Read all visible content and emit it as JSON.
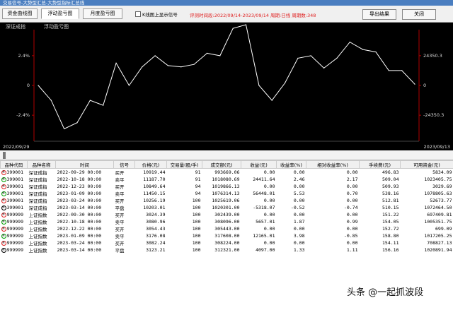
{
  "window_title": "交易信号-大势型汇总-大势型指标汇总线",
  "tabs": [
    {
      "label": "资金曲线图"
    },
    {
      "label": "浮动盈亏图"
    },
    {
      "label": "月度盈亏图"
    }
  ],
  "show_signals_label": "K线图上显示信号",
  "range_info": "评测时间段:2022/09/14-2023/09/14 周期:日线 周期数:348",
  "buttons": {
    "export": "导出结果",
    "close": "关闭"
  },
  "legend": {
    "a": "深证成指",
    "b": "浮动盈亏图"
  },
  "chart_data": {
    "type": "line",
    "x_start_label": "2022/09/29",
    "x_end_label": "2023/09/13",
    "left_ticks": [
      "2.4%",
      "0",
      "-2.4%"
    ],
    "right_ticks": [
      "24350.3",
      "0",
      "-24350.3"
    ],
    "ylim": [
      -4.5,
      4.5
    ],
    "values": [
      0.0,
      -1.2,
      -3.5,
      -3.0,
      -1.2,
      -1.6,
      1.8,
      0.0,
      1.5,
      2.4,
      1.6,
      1.5,
      1.7,
      2.6,
      2.4,
      4.6,
      4.9,
      0.0,
      -1.2,
      0.2,
      2.2,
      2.4,
      1.4,
      2.2,
      3.5,
      2.9,
      2.7,
      1.2,
      1.2,
      0.1
    ],
    "grid": false
  },
  "table": {
    "headers": [
      "品种代码",
      "品种名称",
      "时间",
      "信号",
      "价格(元)",
      "交易量(股/手)",
      "成交额(元)",
      "收益(元)",
      "收益率(%)",
      "相对收益率(%)",
      "手续费(元)",
      "可用资金(元)"
    ],
    "rows": [
      {
        "code": "399001",
        "name": "深证成指",
        "time": "2022-09-29 00:00",
        "signal": "买开",
        "price": "10919.44",
        "qty": "91",
        "amount": "993669.06",
        "profit": "0.00",
        "rate": "0.00",
        "rel": "0.00",
        "fee": "496.83",
        "avail": "5834.09"
      },
      {
        "code": "399001",
        "name": "深证成指",
        "time": "2022-10-18 00:00",
        "signal": "卖平",
        "price": "11187.70",
        "qty": "91",
        "amount": "1018080.69",
        "profit": "24411.64",
        "rate": "2.46",
        "rel": "2.17",
        "fee": "509.04",
        "avail": "1023405.75"
      },
      {
        "code": "399001",
        "name": "深证成指",
        "time": "2022-12-23 00:00",
        "signal": "买开",
        "price": "10849.64",
        "qty": "94",
        "amount": "1019866.13",
        "profit": "0.00",
        "rate": "0.00",
        "rel": "0.00",
        "fee": "509.93",
        "avail": "3029.69"
      },
      {
        "code": "399001",
        "name": "深证成指",
        "time": "2023-01-09 00:00",
        "signal": "卖平",
        "price": "11450.15",
        "qty": "94",
        "amount": "1076314.13",
        "profit": "56448.01",
        "rate": "5.53",
        "rel": "0.70",
        "fee": "538.16",
        "avail": "1078805.63"
      },
      {
        "code": "399001",
        "name": "深证成指",
        "time": "2023-03-24 00:00",
        "signal": "买开",
        "price": "10256.19",
        "qty": "100",
        "amount": "1025619.06",
        "profit": "0.00",
        "rate": "0.00",
        "rel": "0.00",
        "fee": "512.81",
        "avail": "52673.77"
      },
      {
        "code": "399001",
        "name": "深证成指",
        "time": "2023-03-14 00:00",
        "signal": "平盘",
        "price": "10203.01",
        "qty": "100",
        "amount": "1020301.00",
        "profit": "-5318.07",
        "rate": "-0.52",
        "rel": "-0.74",
        "fee": "510.15",
        "avail": "1072464.50"
      },
      {
        "code": "999999",
        "name": "上证指数",
        "time": "2022-09-30 00:00",
        "signal": "买开",
        "price": "3024.39",
        "qty": "100",
        "amount": "302439.00",
        "profit": "0.00",
        "rate": "0.00",
        "rel": "0.00",
        "fee": "151.22",
        "avail": "697409.81"
      },
      {
        "code": "999999",
        "name": "上证指数",
        "time": "2022-10-18 00:00",
        "signal": "卖平",
        "price": "3080.96",
        "qty": "100",
        "amount": "308096.00",
        "profit": "5657.01",
        "rate": "1.87",
        "rel": "0.99",
        "fee": "154.05",
        "avail": "1005351.75"
      },
      {
        "code": "999999",
        "name": "上证指数",
        "time": "2022-12-22 00:00",
        "signal": "买开",
        "price": "3054.43",
        "qty": "100",
        "amount": "305443.00",
        "profit": "0.00",
        "rate": "0.00",
        "rel": "0.00",
        "fee": "152.72",
        "avail": "699.09"
      },
      {
        "code": "999999",
        "name": "上证指数",
        "time": "2023-01-09 00:00",
        "signal": "卖平",
        "price": "3176.08",
        "qty": "100",
        "amount": "317608.00",
        "profit": "12165.01",
        "rate": "3.98",
        "rel": "-0.85",
        "fee": "158.80",
        "avail": "1017205.25"
      },
      {
        "code": "999999",
        "name": "上证指数",
        "time": "2023-03-24 00:00",
        "signal": "买开",
        "price": "3082.24",
        "qty": "100",
        "amount": "308224.00",
        "profit": "0.00",
        "rate": "0.00",
        "rel": "0.00",
        "fee": "154.11",
        "avail": "708827.13"
      },
      {
        "code": "999999",
        "name": "上证指数",
        "time": "2023-03-14 00:00",
        "signal": "平盘",
        "price": "3123.21",
        "qty": "100",
        "amount": "312321.00",
        "profit": "4097.00",
        "rate": "1.33",
        "rel": "1.11",
        "fee": "156.16",
        "avail": "1020891.94"
      }
    ]
  },
  "colors": {
    "buy": "#e02020",
    "sell": "#00a000",
    "line": "#ffffff",
    "axis_left": "#b00000",
    "axis_right": "#b00000"
  },
  "watermark": "头条 @一起抓波段"
}
